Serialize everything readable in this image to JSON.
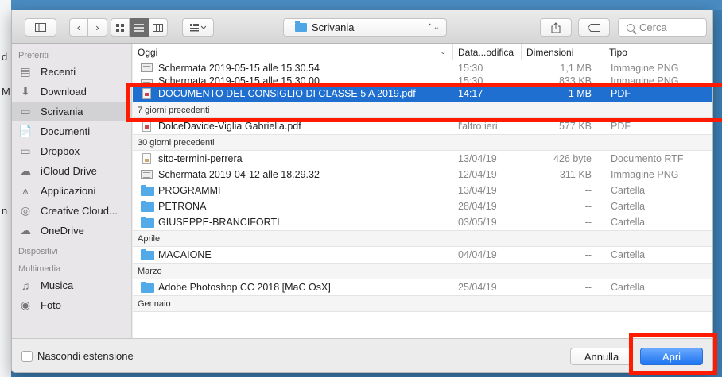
{
  "background": {
    "fragments": [
      "d",
      "M",
      "n"
    ]
  },
  "toolbar": {
    "sidebar_toggle_icon": "sidebar-icon",
    "back_icon": "chevron-left-icon",
    "forward_icon": "chevron-right-icon",
    "view_icons": [
      "icon-view-icon",
      "list-view-icon",
      "column-view-icon"
    ],
    "arrange_icon": "group-icon",
    "location": "Scrivania",
    "share_icon": "share-icon",
    "tag_icon": "tag-icon",
    "search_placeholder": "Cerca"
  },
  "sidebar": {
    "sections": [
      {
        "header": "Preferiti",
        "items": [
          {
            "label": "Recenti",
            "icon": "recents-icon",
            "glyph": "▤"
          },
          {
            "label": "Download",
            "icon": "download-icon",
            "glyph": "⬇"
          },
          {
            "label": "Scrivania",
            "icon": "desktop-icon",
            "glyph": "▭",
            "selected": true
          },
          {
            "label": "Documenti",
            "icon": "documents-icon",
            "glyph": "📄"
          },
          {
            "label": "Dropbox",
            "icon": "folder-icon",
            "glyph": "▭"
          },
          {
            "label": "iCloud Drive",
            "icon": "cloud-icon",
            "glyph": "☁"
          },
          {
            "label": "Applicazioni",
            "icon": "applications-icon",
            "glyph": "⩚"
          },
          {
            "label": "Creative Cloud...",
            "icon": "creative-cloud-icon",
            "glyph": "◎"
          },
          {
            "label": "OneDrive",
            "icon": "onedrive-icon",
            "glyph": "☁"
          }
        ]
      },
      {
        "header": "Dispositivi",
        "items": []
      },
      {
        "header": "Multimedia",
        "items": [
          {
            "label": "Musica",
            "icon": "music-icon",
            "glyph": "♫"
          },
          {
            "label": "Foto",
            "icon": "camera-icon",
            "glyph": "◉"
          }
        ]
      }
    ]
  },
  "list": {
    "columns": [
      "Oggi",
      "Data...odifica",
      "Dimensioni",
      "Tipo"
    ],
    "groups": [
      {
        "label": "",
        "rows": [
          {
            "name": "Schermata 2019-05-15 alle 15.30.54",
            "date": "15:30",
            "size": "1,1 MB",
            "type": "Immagine PNG",
            "icon": "png"
          },
          {
            "name": "Schermata 2019-05-15 alle 15.30.00",
            "date": "15:30",
            "size": "833 KB",
            "type": "Immagine PNG",
            "icon": "png",
            "clipped": true
          },
          {
            "name": "DOCUMENTO DEL CONSIGLIO DI CLASSE 5 A 2019.pdf",
            "date": "14:17",
            "size": "1 MB",
            "type": "PDF",
            "icon": "pdf",
            "selected": true
          }
        ]
      },
      {
        "label": "7 giorni precedenti",
        "rows": [
          {
            "name": "DolceDavide-Viglia Gabriella.pdf",
            "date": "l'altro ieri",
            "size": "577 KB",
            "type": "PDF",
            "icon": "pdf"
          }
        ]
      },
      {
        "label": "30 giorni precedenti",
        "rows": [
          {
            "name": "sito-termini-perrera",
            "date": "13/04/19",
            "size": "426 byte",
            "type": "Documento RTF",
            "icon": "rtf"
          },
          {
            "name": "Schermata 2019-04-12 alle 18.29.32",
            "date": "12/04/19",
            "size": "311 KB",
            "type": "Immagine PNG",
            "icon": "png"
          },
          {
            "name": "PROGRAMMI",
            "date": "13/04/19",
            "size": "--",
            "type": "Cartella",
            "icon": "folder"
          },
          {
            "name": "PETRONA",
            "date": "28/04/19",
            "size": "--",
            "type": "Cartella",
            "icon": "folder"
          },
          {
            "name": "GIUSEPPE-BRANCIFORTI",
            "date": "03/05/19",
            "size": "--",
            "type": "Cartella",
            "icon": "folder"
          }
        ]
      },
      {
        "label": "Aprile",
        "rows": [
          {
            "name": "MACAIONE",
            "date": "04/04/19",
            "size": "--",
            "type": "Cartella",
            "icon": "folder"
          }
        ]
      },
      {
        "label": "Marzo",
        "rows": [
          {
            "name": "Adobe Photoshop CC 2018 [MaC OsX]",
            "date": "25/04/19",
            "size": "--",
            "type": "Cartella",
            "icon": "folder"
          }
        ]
      },
      {
        "label": "Gennaio",
        "rows": []
      }
    ]
  },
  "footer": {
    "hide_extension_label": "Nascondi estensione",
    "cancel_label": "Annulla",
    "open_label": "Apri"
  },
  "colors": {
    "selection": "#1f6fd1",
    "primary_button": "#1e74f0",
    "annotation": "#ff1a00"
  }
}
